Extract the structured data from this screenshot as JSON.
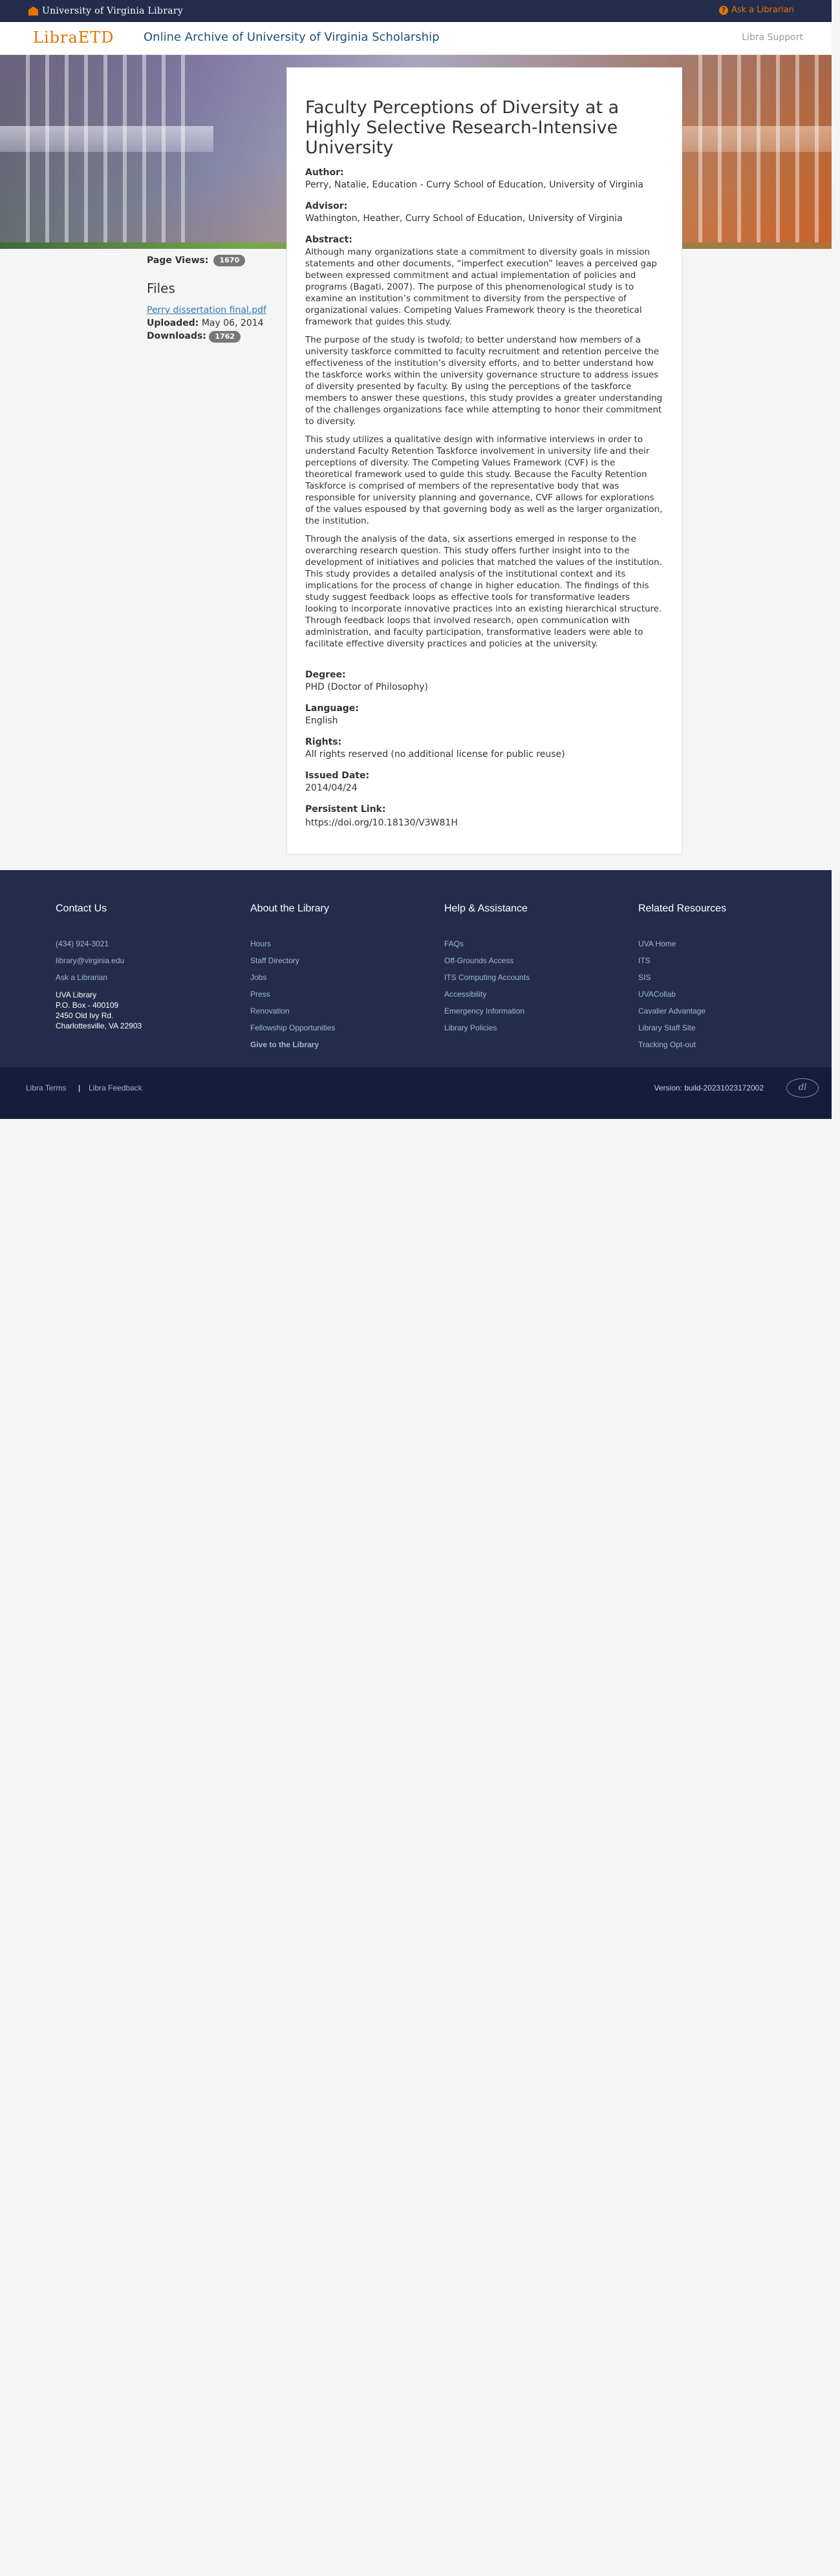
{
  "topbar": {
    "logo_text": "University of Virginia Library",
    "ask_label": "Ask a Librarian"
  },
  "appbar": {
    "logo_text": "LibraETD",
    "title": "Online Archive of University of Virginia Scholarship",
    "support_label": "Libra Support"
  },
  "sidebar": {
    "page_views_label": "Page Views:",
    "page_views": "1670",
    "files_heading": "Files",
    "file_name": "Perry dissertation final.pdf",
    "uploaded_label": "Uploaded:",
    "uploaded": "May 06, 2014",
    "downloads_label": "Downloads:",
    "downloads": "1762"
  },
  "work": {
    "title": "Faculty Perceptions of Diversity at a Highly Selective Research-Intensive University",
    "author_label": "Author:",
    "author": "Perry, Natalie, Education - Curry School of Education, University of Virginia",
    "advisor_label": "Advisor:",
    "advisor": "Wathington, Heather, Curry School of Education, University of Virginia",
    "abstract_label": "Abstract:",
    "abstract": [
      "Although many organizations state a commitment to diversity goals in mission statements and other documents, “imperfect execution” leaves a perceived gap between expressed commitment and actual implementation of policies and programs (Bagati, 2007). The purpose of this phenomenological study is to examine an institution’s commitment to diversity from the perspective of organizational values. Competing Values Framework theory is the theoretical framework that guides this study.",
      "The purpose of the study is twofold; to better understand how members of a university taskforce committed to faculty recruitment and retention perceive the effectiveness of the institution’s diversity efforts, and to better understand how the taskforce works within the university governance structure to address issues of diversity presented by faculty. By using the perceptions of the taskforce members to answer these questions, this study provides a greater understanding of the challenges organizations face while attempting to honor their commitment to diversity.",
      "This study utilizes a qualitative design with informative interviews in order to understand Faculty Retention Taskforce involvement in university life and their perceptions of diversity. The Competing Values Framework (CVF) is the theoretical framework used to guide this study. Because the Faculty Retention Taskforce is comprised of members of the representative body that was responsible for university planning and governance, CVF allows for explorations of the values espoused by that governing body as well as the larger organization, the institution.",
      "Through the analysis of the data, six assertions emerged in response to the overarching research question. This study offers further insight into to the development of initiatives and policies that matched the values of the institution. This study provides a detailed analysis of the institutional context and its implications for the process of change in higher education. The findings of this study suggest feedback loops as effective tools for transformative leaders looking to incorporate innovative practices into an existing hierarchical structure. Through feedback loops that involved research, open communication with administration, and faculty participation, transformative leaders were able to facilitate effective diversity practices and policies at the university."
    ],
    "degree_label": "Degree:",
    "degree": "PHD (Doctor of Philosophy)",
    "language_label": "Language:",
    "language": "English",
    "rights_label": "Rights:",
    "rights": "All rights reserved (no additional license for public reuse)",
    "issued_label": "Issued Date:",
    "issued": "2014/04/24",
    "link_label": "Persistent Link:",
    "link": "https://doi.org/10.18130/V3W81H"
  },
  "footer": {
    "contact": {
      "heading": "Contact Us",
      "phone": "(434) 924-3021",
      "email": "library@virginia.edu",
      "ask": "Ask a Librarian",
      "addr1": "UVA Library",
      "addr2": "P.O. Box - 400109",
      "addr3": "2450 Old Ivy Rd.",
      "addr4": "Charlottesville, VA 22903"
    },
    "about": {
      "heading": "About the Library",
      "links": [
        "Hours",
        "Staff Directory",
        "Jobs",
        "Press",
        "Renovation",
        "Fellowship Opportunities",
        "Give to the Library"
      ]
    },
    "help": {
      "heading": "Help & Assistance",
      "links": [
        "FAQs",
        "Off-Grounds Access",
        "ITS Computing Accounts",
        "Accessibility",
        "Emergency Information",
        "Library Policies"
      ]
    },
    "related": {
      "heading": "Related Resources",
      "links": [
        "UVA Home",
        "ITS",
        "SIS",
        "UVACollab",
        "Cavalier Advantage",
        "Library Staff Site",
        "Tracking Opt-out"
      ]
    },
    "bottom": {
      "terms": "Libra Terms",
      "separator": "|",
      "feedback": "Libra Feedback",
      "version": "Version: build-20231023172002"
    }
  }
}
